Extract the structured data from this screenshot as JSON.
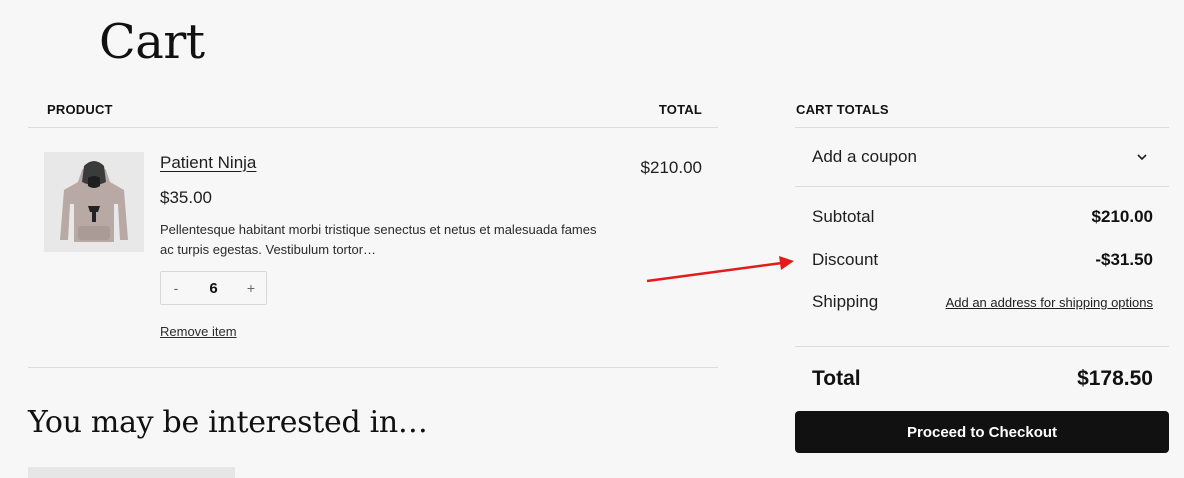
{
  "page": {
    "title": "Cart"
  },
  "cart_table": {
    "product_header": "PRODUCT",
    "total_header": "TOTAL"
  },
  "item": {
    "name": "Patient Ninja",
    "price": "$35.00",
    "description": "Pellentesque habitant morbi tristique senectus et netus et malesuada fames ac turpis egestas. Vestibulum tortor…",
    "quantity": "6",
    "decrement": "-",
    "increment": "+",
    "remove_label": "Remove item",
    "line_total": "$210.00",
    "image_icon": "hoodie-image"
  },
  "interested": {
    "heading": "You may be interested in…"
  },
  "totals": {
    "header": "CART TOTALS",
    "coupon_label": "Add a coupon",
    "subtotal_label": "Subtotal",
    "subtotal_value": "$210.00",
    "discount_label": "Discount",
    "discount_value": "-$31.50",
    "shipping_label": "Shipping",
    "shipping_link": "Add an address for shipping options",
    "total_label": "Total",
    "total_value": "$178.50",
    "checkout_label": "Proceed to Checkout"
  },
  "colors": {
    "background": "#f7f7f7",
    "button": "#111111",
    "annotation_arrow": "#e31b1b"
  }
}
